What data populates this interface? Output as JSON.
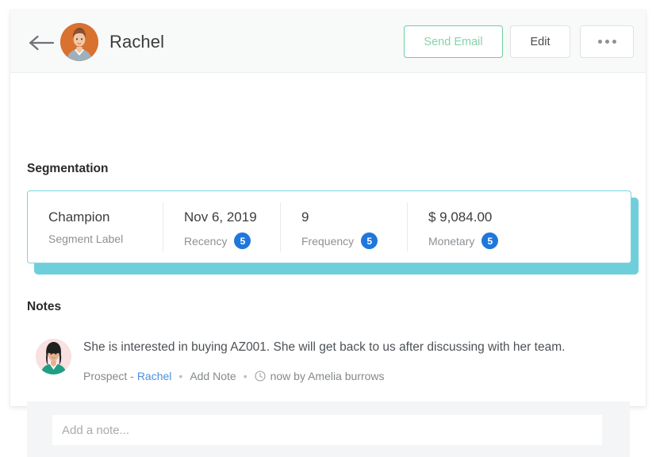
{
  "header": {
    "back_icon": "arrow-left-icon",
    "avatar_icon": "user-avatar-rachel",
    "profile_name": "Rachel",
    "buttons": {
      "send_email": "Send Email",
      "edit": "Edit",
      "more": "more-horizontal-icon"
    },
    "colors": {
      "send_email_border": "#6ecf9b",
      "send_email_text": "#85d4a8",
      "header_bg": "#f8f9f9",
      "avatar_bg": "#d9712f"
    }
  },
  "segmentation": {
    "title": "Segmentation",
    "accent_color": "#6ecfda",
    "badge_color": "#1f77dc",
    "cells": [
      {
        "value": "Champion",
        "label": "Segment Label",
        "badge": ""
      },
      {
        "value": "Nov 6, 2019",
        "label": "Recency",
        "badge": "5"
      },
      {
        "value": "9",
        "label": "Frequency",
        "badge": "5"
      },
      {
        "value": "$ 9,084.00",
        "label": "Monetary",
        "badge": "5"
      }
    ]
  },
  "notes": {
    "title": "Notes",
    "entry": {
      "avatar_icon": "user-avatar-amelia",
      "text": "She is interested in buying AZ001. She will get back to us after discussing with her team.",
      "meta": {
        "prefix": "Prospect -",
        "link": "Rachel",
        "add_note": "Add Note",
        "separator": "•",
        "time_icon": "clock-icon",
        "time": "now by Amelia burrows"
      },
      "link_color": "#4d8fe0"
    },
    "composer": {
      "placeholder": "Add a note...",
      "value": ""
    }
  }
}
